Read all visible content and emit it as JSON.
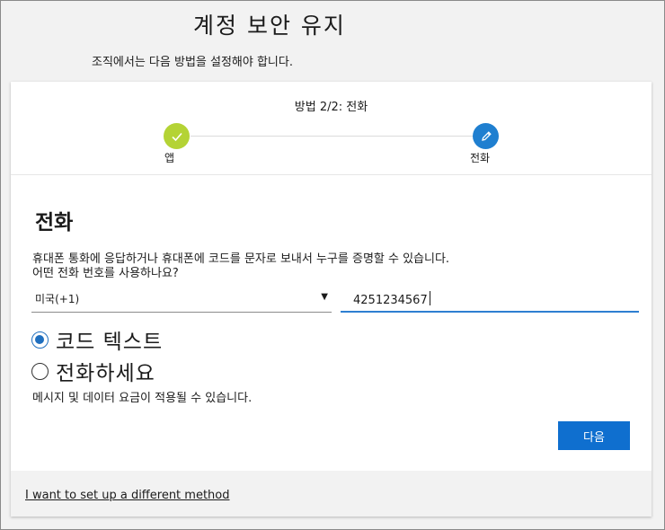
{
  "header": {
    "title": "계정 보안 유지",
    "subtitle": "조직에서는 다음 방법을 설정해야 합니다."
  },
  "progress": {
    "heading": "방법 2/2: 전화",
    "steps": [
      {
        "label": "앱",
        "state": "done",
        "icon": "check-icon",
        "color": "#b4d335"
      },
      {
        "label": "전화",
        "state": "current",
        "icon": "pencil-icon",
        "color": "#1f7fd0"
      }
    ]
  },
  "phone": {
    "title": "전화",
    "description_line1": "휴대폰 통화에 응답하거나 휴대폰에 코드를 문자로 보내서 누구를 증명할 수 있습니다.",
    "description_line2": "어떤 전화 번호를 사용하나요?",
    "country_value": "미국(+1)",
    "phone_value": "4251234567",
    "options": [
      {
        "label": "코드 텍스트",
        "checked": true
      },
      {
        "label": "전화하세요",
        "checked": false
      }
    ],
    "note": "메시지 및 데이터 요금이 적용될 수 있습니다.",
    "next_label": "다음"
  },
  "footer": {
    "alt_method_link": "I want to set up a different method"
  },
  "colors": {
    "accent": "#0f6fcf",
    "step_done": "#b4d335",
    "step_current": "#1f7fd0"
  }
}
